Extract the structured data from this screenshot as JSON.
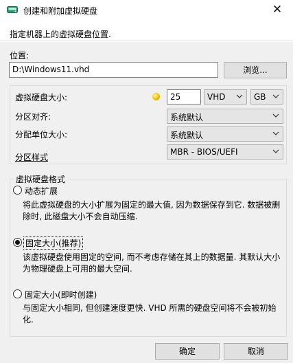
{
  "window": {
    "title": "创建和附加虚拟硬盘",
    "close_label": "✕"
  },
  "header": {
    "text": "指定机器上的虚拟硬盘位置."
  },
  "location": {
    "label": "位置:",
    "path_value": "D:\\Windows11.vhd",
    "browse_label": "浏览..."
  },
  "disk": {
    "size_label": "虚拟硬盘大小:",
    "size_value": "25",
    "type_selected": "VHD",
    "unit_selected": "GB",
    "alignment_label": "分区对齐:",
    "alignment_selected": "系统默认",
    "allocation_label": "分配单位大小:",
    "allocation_selected": "系统默认",
    "partition_style_label": "分区样式",
    "partition_style_selected": "MBR - BIOS/UEFI"
  },
  "format": {
    "legend": "虚拟硬盘格式",
    "options": [
      {
        "label": "动态扩展",
        "desc": "将此虚拟硬盘的大小扩展为固定的最大值, 因为数据保存到它. 数据被删除时, 此磁盘大小不会自动压缩.",
        "checked": false
      },
      {
        "label": "固定大小(推荐)",
        "desc": "该虚拟硬盘使用固定的空间, 而不考虑存储在其上的数据量. 其默认大小为物理硬盘上可用的最大空间.",
        "checked": true
      },
      {
        "label": "固定大小(即时创建)",
        "desc": "与固定大小相同, 但创建速度更快. VHD 所需的硬盘空间将不会被初始化.",
        "checked": false
      }
    ]
  },
  "footer": {
    "ok_label": "确定",
    "cancel_label": "取消"
  },
  "colors": {
    "title_icon": "#2f9e73",
    "coin": "#f0c000"
  }
}
